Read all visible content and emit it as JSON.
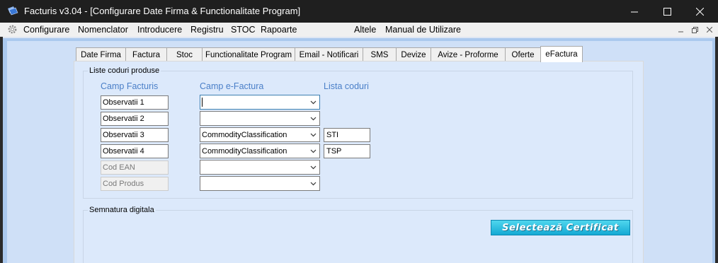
{
  "window": {
    "title": "Facturis v3.04 - [Configurare Date Firma & Functionalitate Program]"
  },
  "menu": {
    "items": [
      "Configurare",
      "Nomenclator",
      "Introducere",
      "Registru",
      "STOC",
      "Rapoarte"
    ],
    "right_items": [
      "Altele",
      "Manual de Utilizare"
    ]
  },
  "tabs": [
    "Date Firma",
    "Factura",
    "Stoc",
    "Functionalitate Program",
    "Email - Notificari",
    "SMS",
    "Devize",
    "Avize - Proforme",
    "Oferte",
    "eFactura"
  ],
  "active_tab": "eFactura",
  "liste": {
    "group_label": "Liste coduri produse",
    "headers": {
      "camp_facturis": "Camp Facturis",
      "camp_efactura": "Camp e-Factura",
      "lista_coduri": "Lista coduri"
    },
    "rows": [
      {
        "field": "Observatii 1",
        "enabled": true,
        "efactura": "",
        "code": null
      },
      {
        "field": "Observatii 2",
        "enabled": true,
        "efactura": "",
        "code": null
      },
      {
        "field": "Observatii 3",
        "enabled": true,
        "efactura": "CommodityClassification",
        "code": "STI"
      },
      {
        "field": "Observatii 4",
        "enabled": true,
        "efactura": "CommodityClassification",
        "code": "TSP"
      },
      {
        "field": "Cod EAN",
        "enabled": false,
        "efactura": "",
        "code": null
      },
      {
        "field": "Cod Produs",
        "enabled": false,
        "efactura": "",
        "code": null
      }
    ]
  },
  "semnatura": {
    "group_label": "Semnatura digitala",
    "button_label": "Selectează Certificat"
  },
  "colors": {
    "titlebar": "#1f1f1f",
    "mdi_background": "#abc9ee",
    "form_background": "#cfe0f7",
    "tabpage_background": "#dce9fb",
    "column_header": "#4a7fc8",
    "certificate_button": "#1cb4dc"
  },
  "icons": {
    "app": "facturis-app-icon",
    "menu": "gear-icon",
    "combo_arrow": "chevron-down-icon"
  }
}
